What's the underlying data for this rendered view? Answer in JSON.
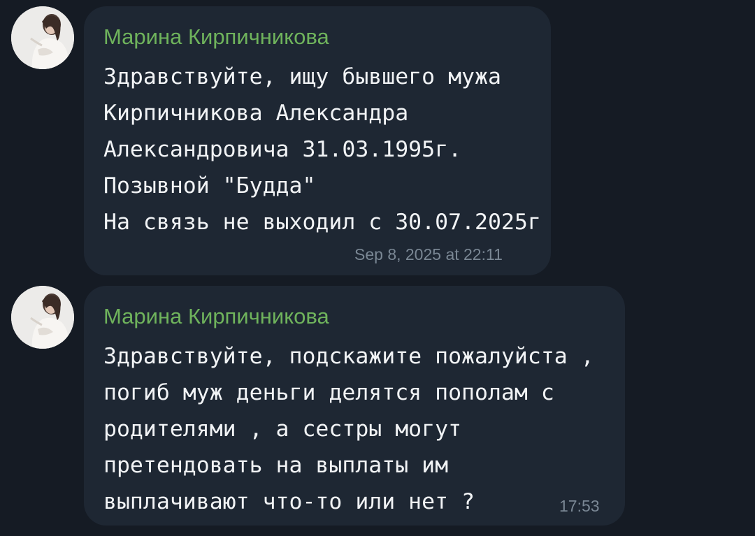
{
  "conversation": {
    "messages": [
      {
        "sender": "Марина Кирпичникова",
        "text": "Здравствуйте, ищу бывшего мужа\nКирпичникова Александра\nАлександровича 31.03.1995г.\nПозывной \"Будда\"\nНа связь не выходил с 30.07.2025г",
        "time": "Sep 8, 2025 at 22:11"
      },
      {
        "sender": "Марина Кирпичникова",
        "text": "Здравствуйте, подскажите пожалуйста ,\nпогиб муж деньги делятся пополам с\nродителями , а сестры могут\nпретендовать на выплаты им\nвыплачивают что-то или нет ?",
        "time": "17:53"
      }
    ]
  },
  "colors": {
    "background": "#151b24",
    "bubble": "#1e2733",
    "sender_name": "#6fb35c",
    "message_text": "#f1f3f5",
    "timestamp": "#7a8794"
  },
  "icons": {
    "avatar": "user-avatar-photo"
  }
}
